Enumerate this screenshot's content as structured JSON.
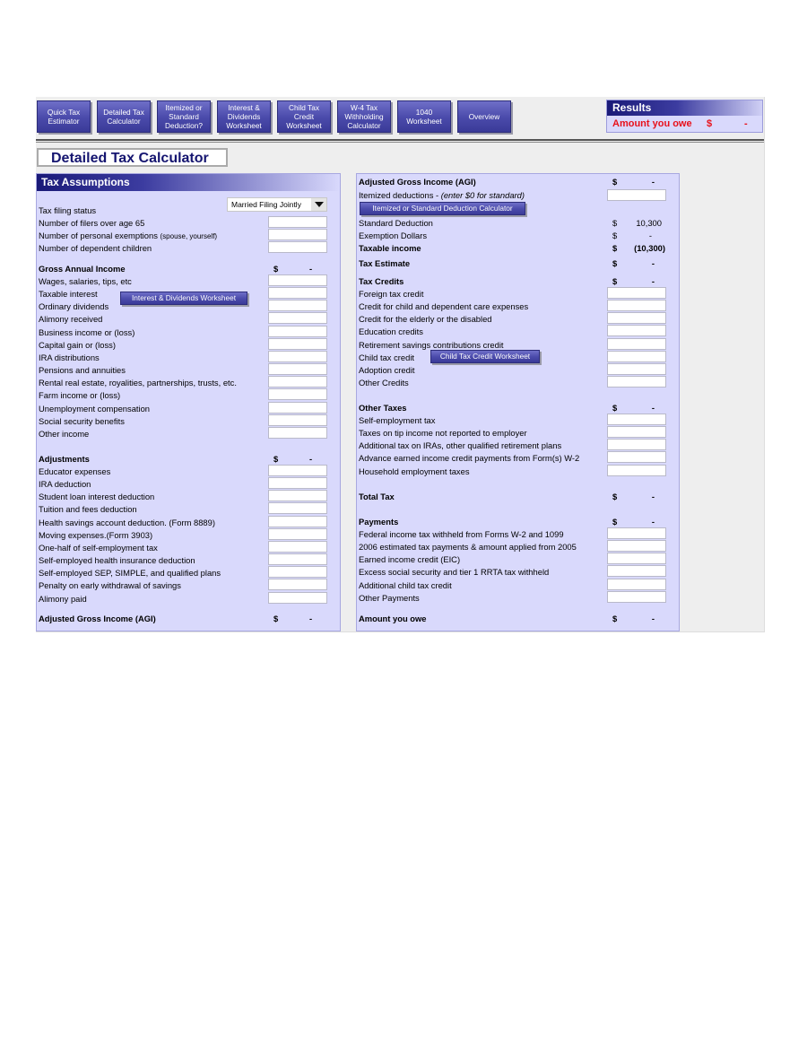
{
  "nav": {
    "buttons": [
      {
        "label": "Quick Tax Estimator"
      },
      {
        "label": "Detailed Tax Calculator"
      },
      {
        "label": "Itemized or Standard Deduction?"
      },
      {
        "label": "Interest & Dividends Worksheet"
      },
      {
        "label": "Child Tax Credit Worksheet"
      },
      {
        "label": "W-4 Tax Withholding Calculator"
      },
      {
        "label": "1040 Worksheet"
      },
      {
        "label": "Overview"
      }
    ]
  },
  "results": {
    "title": "Results",
    "label": "Amount you owe",
    "currency": "$",
    "value": "-",
    "color": "#e8101a"
  },
  "page_title": "Detailed Tax Calculator",
  "left": {
    "header": "Tax Assumptions",
    "filing_status_label": "Tax filing status",
    "filing_status_value": "Married Filing Jointly",
    "filers_over_65": "Number of filers over age 65",
    "personal_exemptions": "Number of personal exemptions",
    "personal_exemptions_note": "(spouse, yourself)",
    "dependent_children": "Number of dependent children",
    "gross_income": {
      "title": "Gross Annual Income",
      "currency": "$",
      "total": "-",
      "items": [
        "Wages, salaries, tips, etc",
        "Taxable interest",
        "Ordinary dividends",
        "Alimony received",
        "Business income or (loss)",
        "Capital gain or (loss)",
        "IRA distributions",
        "Pensions and annuities",
        "Rental real estate, royalities, partnerships, trusts, etc.",
        "Farm income or (loss)",
        "Unemployment compensation",
        "Social security benefits",
        "Other income"
      ],
      "worksheet_button": "Interest & Dividends Worksheet"
    },
    "adjustments": {
      "title": "Adjustments",
      "currency": "$",
      "total": "-",
      "items": [
        "Educator expenses",
        "IRA deduction",
        "Student loan interest deduction",
        "Tuition and fees deduction",
        "Health savings account deduction. (Form 8889)",
        "Moving expenses.(Form 3903)",
        "One-half of self-employment tax",
        "Self-employed health insurance deduction",
        "Self-employed SEP, SIMPLE, and qualified plans",
        "Penalty on early withdrawal of savings",
        "Alimony paid"
      ]
    },
    "agi": {
      "label": "Adjusted Gross Income (AGI)",
      "currency": "$",
      "value": "-"
    }
  },
  "right": {
    "agi": {
      "label": "Adjusted Gross Income (AGI)",
      "currency": "$",
      "value": "-"
    },
    "itemized_label": "Itemized deductions - ",
    "itemized_note": "(enter $0 for standard)",
    "deduction_calc_button": "Itemized or Standard Deduction Calculator",
    "standard_deduction": {
      "label": "Standard Deduction",
      "currency": "$",
      "value": "10,300"
    },
    "exemption_dollars": {
      "label": "Exemption Dollars",
      "currency": "$",
      "value": "-"
    },
    "taxable_income": {
      "label": "Taxable income",
      "currency": "$",
      "value": "(10,300)"
    },
    "tax_estimate": {
      "label": "Tax Estimate",
      "currency": "$",
      "value": "-"
    },
    "tax_credits": {
      "title": "Tax Credits",
      "currency": "$",
      "total": "-",
      "items": [
        "Foreign tax credit",
        "Credit for child and dependent care expenses",
        "Credit for the elderly or the disabled",
        "Education credits",
        "Retirement savings contributions credit",
        "Child tax credit",
        "Adoption credit",
        "Other Credits"
      ],
      "worksheet_button": "Child Tax Credit Worksheet"
    },
    "other_taxes": {
      "title": "Other Taxes",
      "currency": "$",
      "total": "-",
      "items": [
        "Self-employment tax",
        "Taxes on tip income not reported to employer",
        "Additional tax on IRAs, other qualified retirement plans",
        "Advance earned income credit payments from Form(s) W-2",
        "Household employment taxes"
      ]
    },
    "total_tax": {
      "label": "Total Tax",
      "currency": "$",
      "value": "-"
    },
    "payments": {
      "title": "Payments",
      "currency": "$",
      "total": "-",
      "items": [
        "Federal income tax withheld from Forms W-2 and 1099",
        "2006 estimated tax payments & amount applied from 2005",
        "Earned income credit (EIC)",
        "Excess social security and tier 1 RRTA tax withheld",
        "Additional child tax credit",
        "Other Payments"
      ]
    },
    "amount_owe": {
      "label": "Amount you owe",
      "currency": "$",
      "value": "-"
    }
  }
}
